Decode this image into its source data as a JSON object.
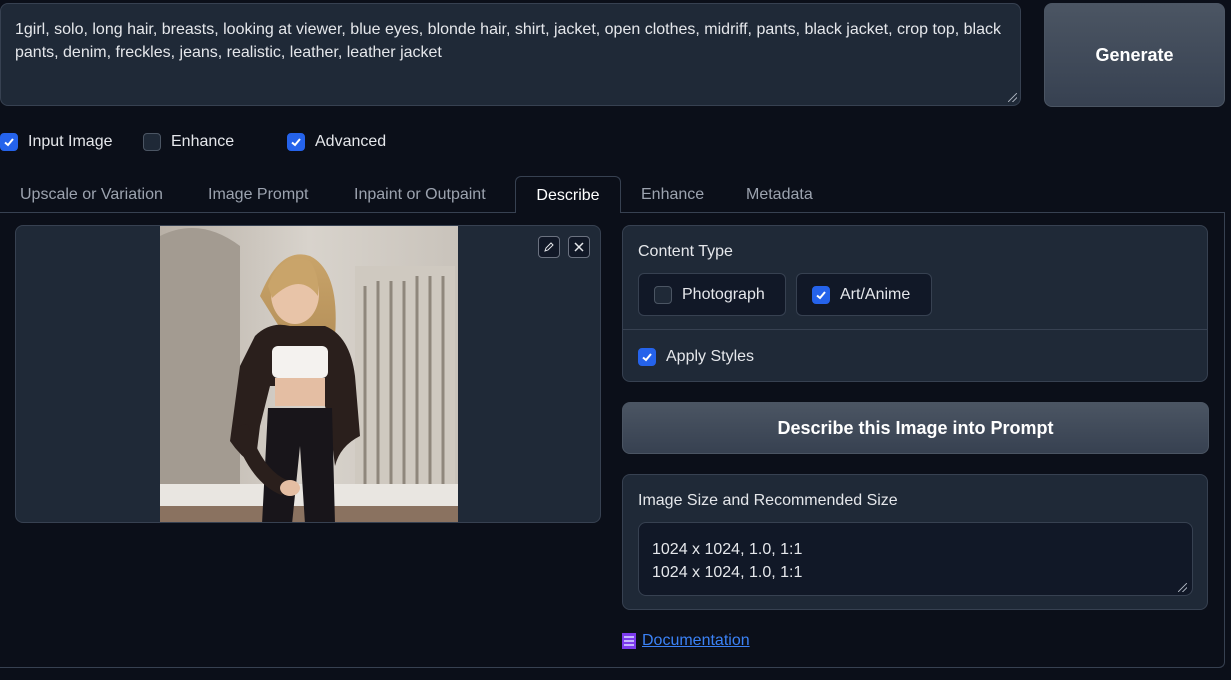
{
  "prompt": {
    "text": "1girl, solo, long hair, breasts, looking at viewer, blue eyes, blonde hair, shirt, jacket, open clothes, midriff, pants, black jacket, crop top, black pants, denim, freckles, jeans, realistic, leather, leather jacket"
  },
  "generate_label": "Generate",
  "options": [
    {
      "label": "Input Image",
      "checked": true
    },
    {
      "label": "Enhance",
      "checked": false
    },
    {
      "label": "Advanced",
      "checked": true
    }
  ],
  "tabs": [
    {
      "label": "Upscale or Variation"
    },
    {
      "label": "Image Prompt"
    },
    {
      "label": "Inpaint or Outpaint"
    },
    {
      "label": "Describe",
      "active": true
    },
    {
      "label": "Enhance"
    },
    {
      "label": "Metadata"
    }
  ],
  "content_type": {
    "title": "Content Type",
    "choices": [
      {
        "label": "Photograph",
        "checked": false
      },
      {
        "label": "Art/Anime",
        "checked": true
      }
    ],
    "apply_styles": {
      "label": "Apply Styles",
      "checked": true
    }
  },
  "describe_button": "Describe this Image into Prompt",
  "image_size": {
    "title": "Image Size and Recommended Size",
    "value": "1024 x 1024, 1.0, 1:1\n1024 x 1024, 1.0, 1:1"
  },
  "documentation": {
    "label": "Documentation",
    "icon": "book-icon"
  },
  "colors": {
    "accent": "#2563eb",
    "background": "#0b0f19",
    "panel": "#1f2937",
    "link": "#3b82f6"
  }
}
